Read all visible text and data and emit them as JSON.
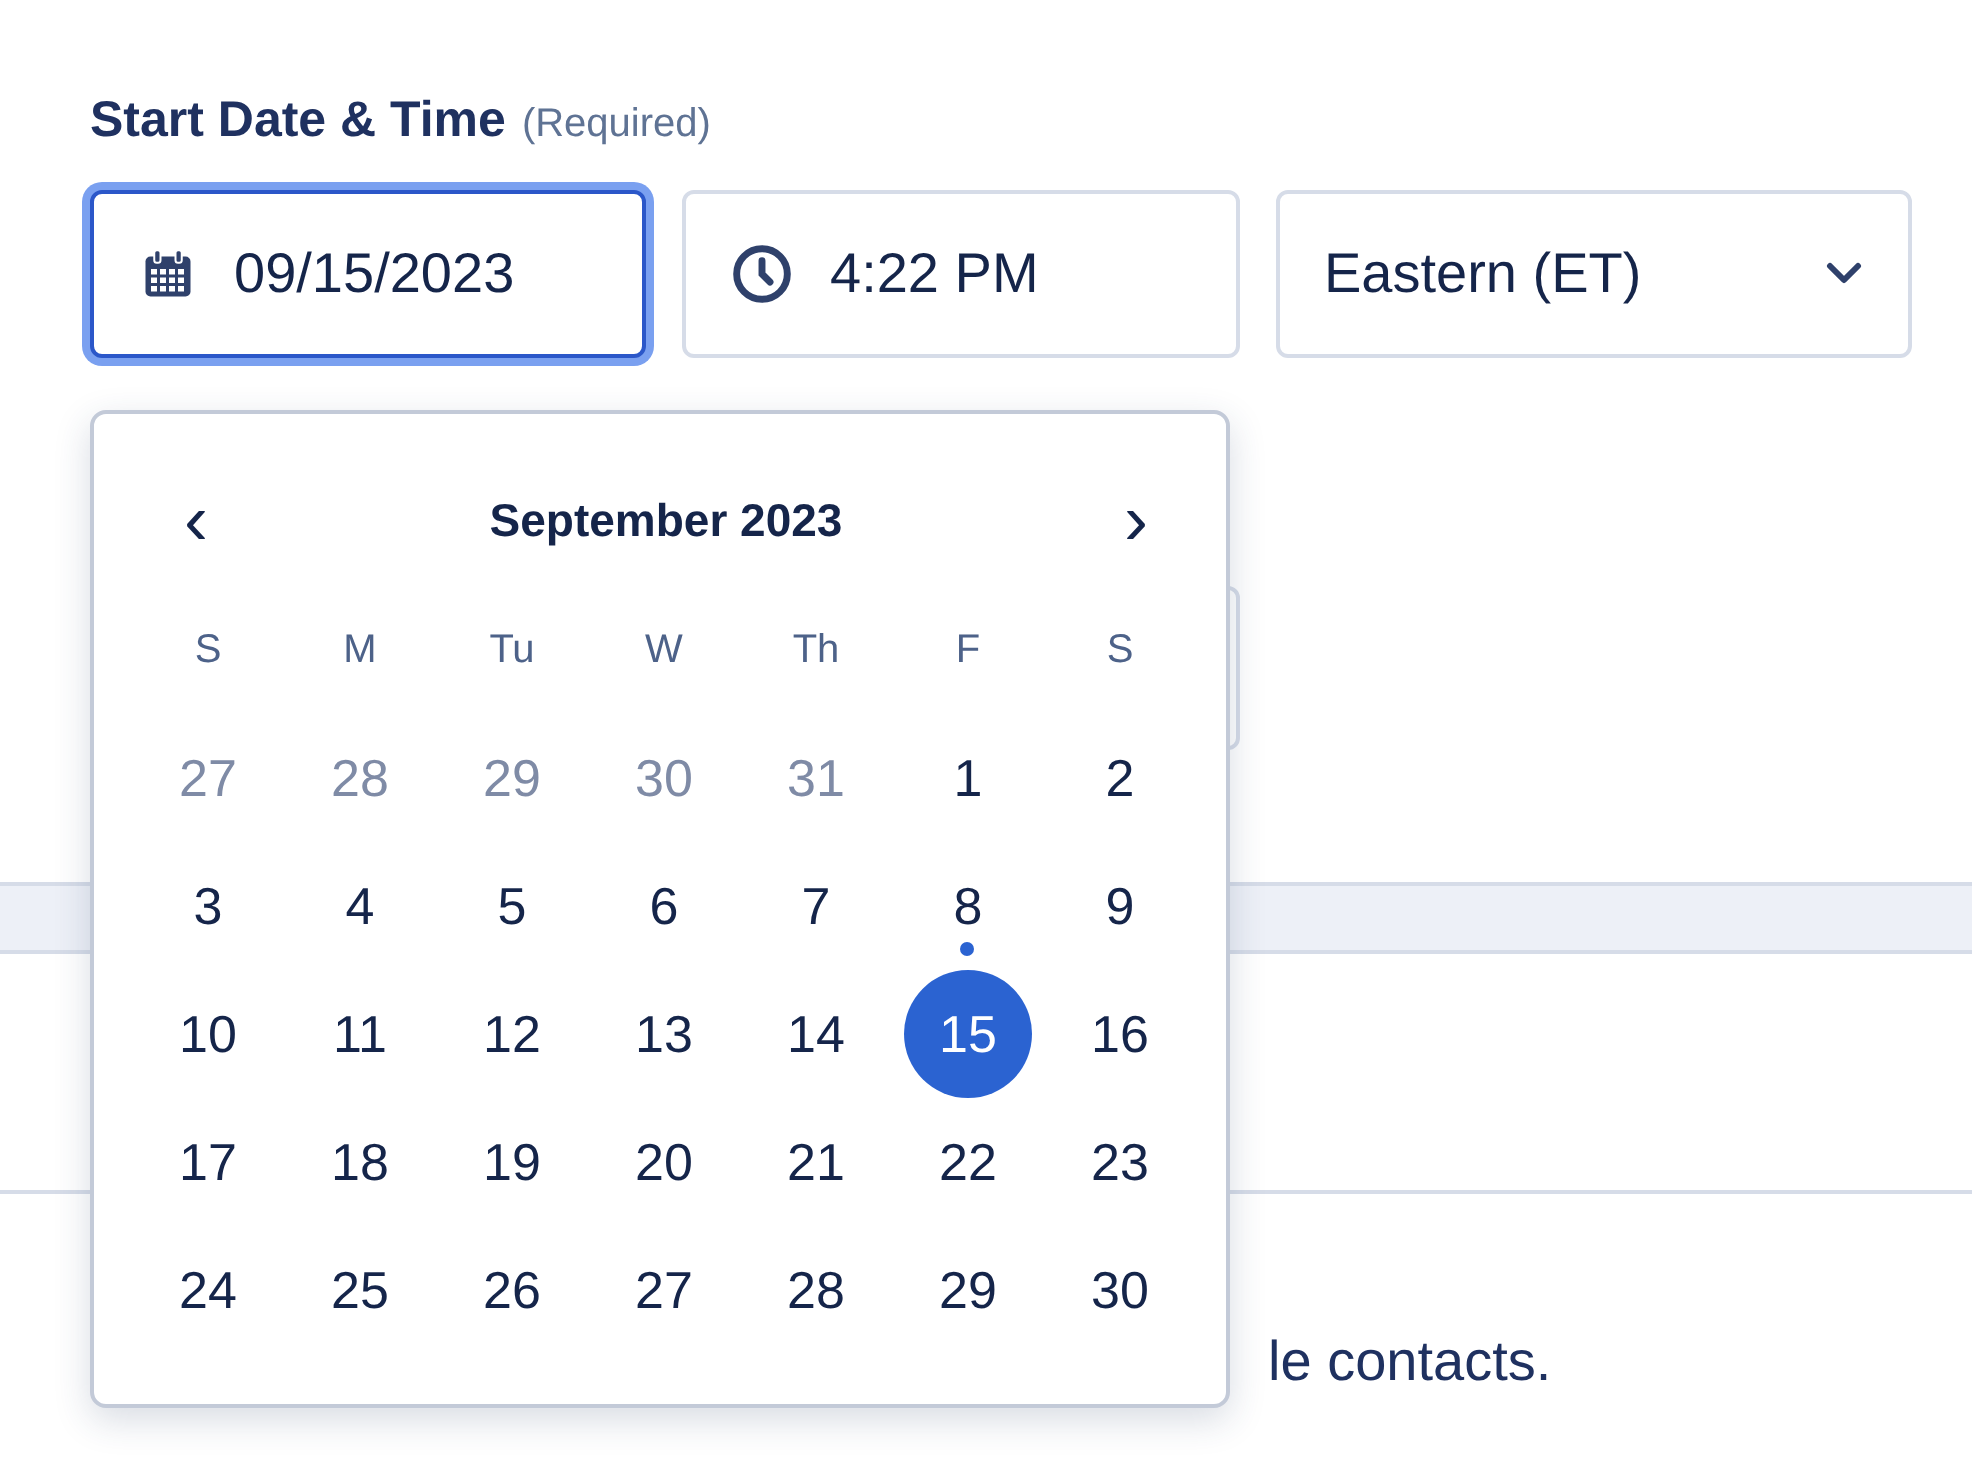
{
  "label": {
    "title": "Start Date & Time",
    "hint": "(Required)"
  },
  "date_field": {
    "value": "09/15/2023",
    "focused": true
  },
  "time_field": {
    "value": "4:22 PM"
  },
  "timezone": {
    "value": "Eastern (ET)"
  },
  "background_text": "le contacts.",
  "calendar": {
    "prev": "‹",
    "next": "›",
    "month": "September 2023",
    "weekdays": [
      "S",
      "M",
      "Tu",
      "W",
      "Th",
      "F",
      "S"
    ],
    "weeks": [
      [
        {
          "day": "27",
          "outside": true,
          "selected": false,
          "today": false
        },
        {
          "day": "28",
          "outside": true,
          "selected": false,
          "today": false
        },
        {
          "day": "29",
          "outside": true,
          "selected": false,
          "today": false
        },
        {
          "day": "30",
          "outside": true,
          "selected": false,
          "today": false
        },
        {
          "day": "31",
          "outside": true,
          "selected": false,
          "today": false
        },
        {
          "day": "1",
          "outside": false,
          "selected": false,
          "today": false
        },
        {
          "day": "2",
          "outside": false,
          "selected": false,
          "today": false
        }
      ],
      [
        {
          "day": "3",
          "outside": false,
          "selected": false,
          "today": false
        },
        {
          "day": "4",
          "outside": false,
          "selected": false,
          "today": false
        },
        {
          "day": "5",
          "outside": false,
          "selected": false,
          "today": false
        },
        {
          "day": "6",
          "outside": false,
          "selected": false,
          "today": false
        },
        {
          "day": "7",
          "outside": false,
          "selected": false,
          "today": false
        },
        {
          "day": "8",
          "outside": false,
          "selected": false,
          "today": true
        },
        {
          "day": "9",
          "outside": false,
          "selected": false,
          "today": false
        }
      ],
      [
        {
          "day": "10",
          "outside": false,
          "selected": false,
          "today": false
        },
        {
          "day": "11",
          "outside": false,
          "selected": false,
          "today": false
        },
        {
          "day": "12",
          "outside": false,
          "selected": false,
          "today": false
        },
        {
          "day": "13",
          "outside": false,
          "selected": false,
          "today": false
        },
        {
          "day": "14",
          "outside": false,
          "selected": false,
          "today": false
        },
        {
          "day": "15",
          "outside": false,
          "selected": true,
          "today": false
        },
        {
          "day": "16",
          "outside": false,
          "selected": false,
          "today": false
        }
      ],
      [
        {
          "day": "17",
          "outside": false,
          "selected": false,
          "today": false
        },
        {
          "day": "18",
          "outside": false,
          "selected": false,
          "today": false
        },
        {
          "day": "19",
          "outside": false,
          "selected": false,
          "today": false
        },
        {
          "day": "20",
          "outside": false,
          "selected": false,
          "today": false
        },
        {
          "day": "21",
          "outside": false,
          "selected": false,
          "today": false
        },
        {
          "day": "22",
          "outside": false,
          "selected": false,
          "today": false
        },
        {
          "day": "23",
          "outside": false,
          "selected": false,
          "today": false
        }
      ],
      [
        {
          "day": "24",
          "outside": false,
          "selected": false,
          "today": false
        },
        {
          "day": "25",
          "outside": false,
          "selected": false,
          "today": false
        },
        {
          "day": "26",
          "outside": false,
          "selected": false,
          "today": false
        },
        {
          "day": "27",
          "outside": false,
          "selected": false,
          "today": false
        },
        {
          "day": "28",
          "outside": false,
          "selected": false,
          "today": false
        },
        {
          "day": "29",
          "outside": false,
          "selected": false,
          "today": false
        },
        {
          "day": "30",
          "outside": false,
          "selected": false,
          "today": false
        }
      ]
    ]
  }
}
